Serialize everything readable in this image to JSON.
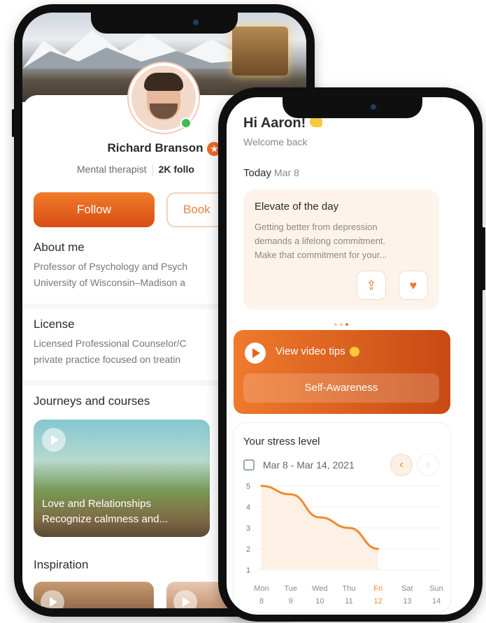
{
  "profile": {
    "name": "Richard Branson",
    "role": "Mental therapist",
    "followers": "2K follo",
    "follow_label": "Follow",
    "book_label": "Book",
    "about_title": "About me",
    "about_lines": [
      "Professor of Psychology and Psych",
      "University of Wisconsin–Madison a"
    ],
    "license_title": "License",
    "license_lines": [
      "Licensed Professional Counselor/C",
      "private practice focused on treatin"
    ],
    "journeys_title": "Journeys and courses",
    "course_lines": [
      "Love and Relationships",
      "Recognize calmness and..."
    ],
    "inspiration_title": "Inspiration"
  },
  "home": {
    "greeting": "Hi Aaron!",
    "welcome": "Welcome back",
    "today_label": "Today",
    "today_date": "Mar 8",
    "elevate_title": "Elevate of the day",
    "elevate_lines": [
      "Getting better from depression",
      "demands a lifelong commitment.",
      "Make that commitment for your..."
    ],
    "video_label": "View video tips",
    "video_button": "Self-Awareness",
    "stress_title": "Your stress level",
    "stress_range": "Mar 8 - Mar 14, 2021"
  },
  "icons": {
    "back": "arrow-left-icon",
    "share": "share-icon",
    "heart": "heart-icon",
    "calendar": "calendar-icon",
    "prev": "chevron-left-icon",
    "next": "chevron-right-icon"
  },
  "colors": {
    "accent": "#ef7a2c",
    "accent_dark": "#d94d14",
    "online": "#3dbb55"
  },
  "chart_data": {
    "type": "line",
    "title": "Your stress level",
    "categories": [
      {
        "day": "Mon",
        "date": "8"
      },
      {
        "day": "Tue",
        "date": "9"
      },
      {
        "day": "Wed",
        "date": "10"
      },
      {
        "day": "Thu",
        "date": "11"
      },
      {
        "day": "Fri",
        "date": "12"
      },
      {
        "day": "Sat",
        "date": "13"
      },
      {
        "day": "Sun",
        "date": "14"
      }
    ],
    "values": [
      5,
      4.6,
      3.5,
      3,
      2
    ],
    "highlight_index": 4,
    "ylim": [
      1,
      5
    ],
    "yticks": [
      "1",
      "2",
      "3",
      "4",
      "5"
    ],
    "grid": true
  }
}
